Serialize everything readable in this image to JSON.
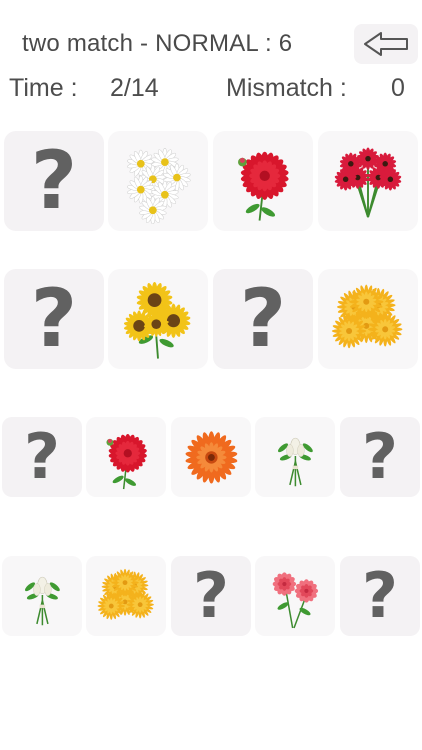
{
  "header": {
    "title": "two match - NORMAL : 6",
    "time_label": "Time :",
    "time_value": "2/14",
    "mismatch_label": "Mismatch :",
    "mismatch_value": "0"
  },
  "colors": {
    "card_bg": "#f4f2f4",
    "question_mark": "#616161",
    "text": "#4a4a4a"
  },
  "unknown_symbol": "?",
  "cards": [
    {
      "state": "hidden"
    },
    {
      "state": "revealed",
      "flower": "white-daisy"
    },
    {
      "state": "revealed",
      "flower": "red-dahlia"
    },
    {
      "state": "revealed",
      "flower": "red-gerbera-bouquet"
    },
    {
      "state": "hidden"
    },
    {
      "state": "revealed",
      "flower": "sunflower-bouquet"
    },
    {
      "state": "hidden"
    },
    {
      "state": "revealed",
      "flower": "yellow-chrysanthemum"
    },
    {
      "state": "hidden"
    },
    {
      "state": "revealed",
      "flower": "red-dahlia"
    },
    {
      "state": "revealed",
      "flower": "orange-gerbera"
    },
    {
      "state": "revealed",
      "flower": "white-bud-bouquet"
    },
    {
      "state": "hidden"
    },
    {
      "state": "revealed",
      "flower": "white-bud-bouquet"
    },
    {
      "state": "revealed",
      "flower": "yellow-chrysanthemum"
    },
    {
      "state": "hidden"
    },
    {
      "state": "revealed",
      "flower": "pink-peony"
    },
    {
      "state": "hidden"
    }
  ]
}
